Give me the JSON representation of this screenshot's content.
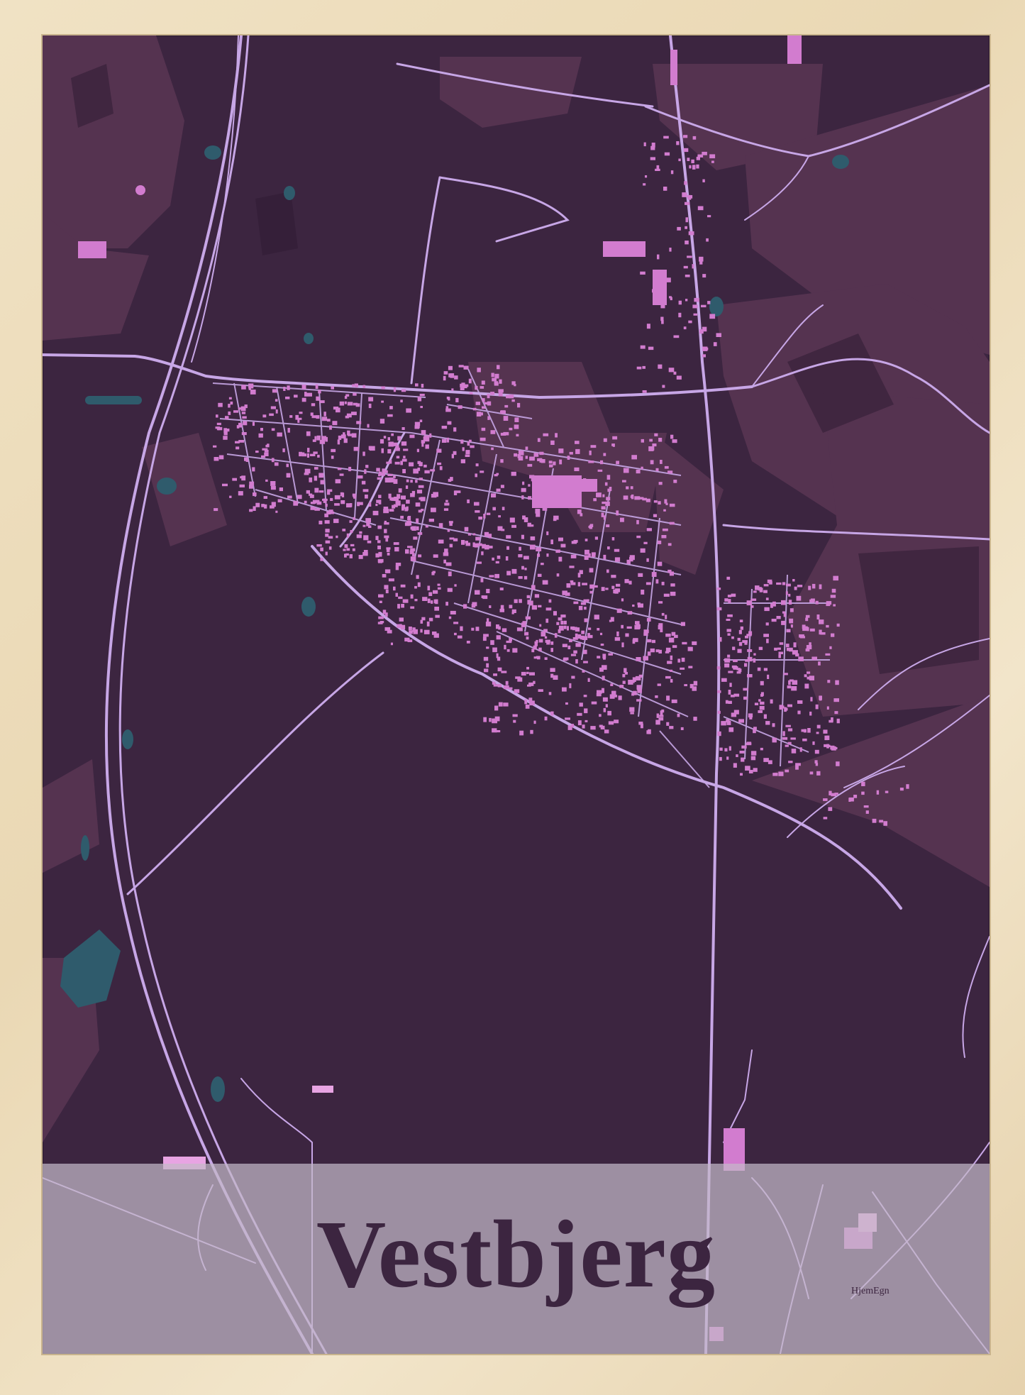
{
  "poster": {
    "title": "Vestbjerg",
    "brand": "HjemEgn"
  },
  "colors": {
    "background": "#3c2540",
    "farmland": "#553350",
    "roads": "#c7a6e6",
    "buildings": "#d27ccf",
    "water": "#2f5b6c",
    "title_band": "#c4b8c8",
    "title_text": "#3c2540",
    "frame": "#ecdcb9"
  },
  "map": {
    "features": [
      "roads",
      "buildings",
      "water",
      "farmland",
      "railway"
    ]
  }
}
